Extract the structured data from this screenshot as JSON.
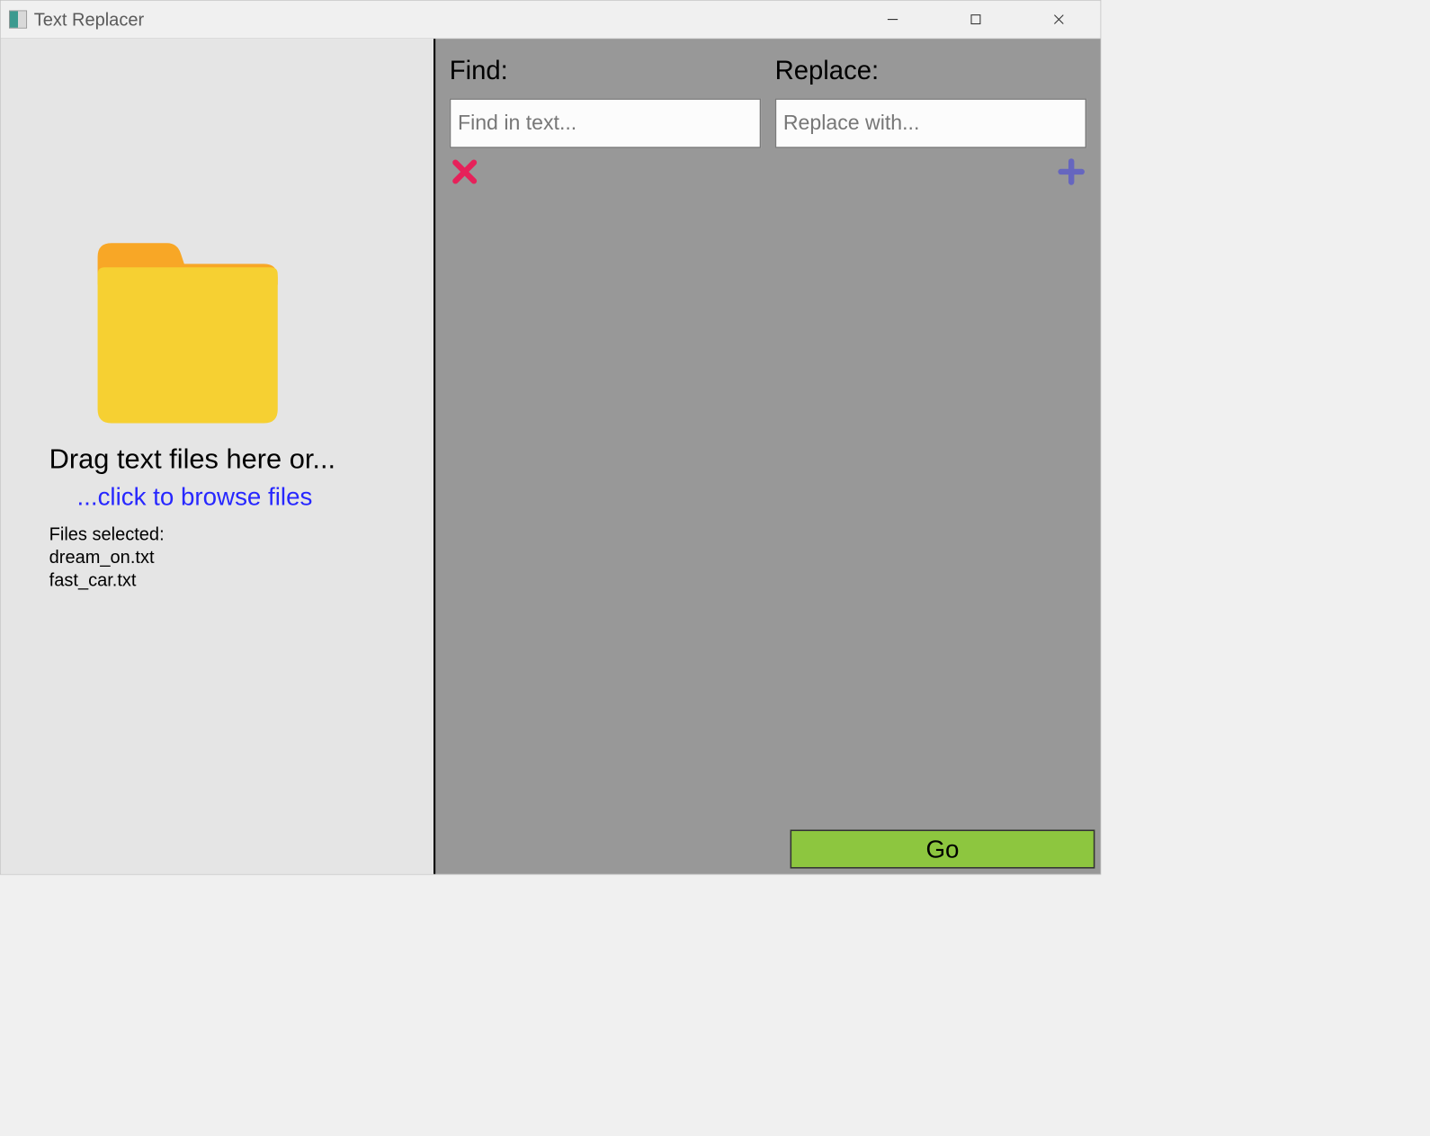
{
  "window": {
    "title": "Text Replacer"
  },
  "left": {
    "drag_label": "Drag text files here or...",
    "browse_label": "...click to browse files",
    "files_header": "Files selected:",
    "files": [
      "dream_on.txt",
      "fast_car.txt"
    ]
  },
  "right": {
    "find_label": "Find:",
    "replace_label": "Replace:",
    "find_placeholder": "Find in text...",
    "replace_placeholder": "Replace with...",
    "go_label": "Go"
  }
}
